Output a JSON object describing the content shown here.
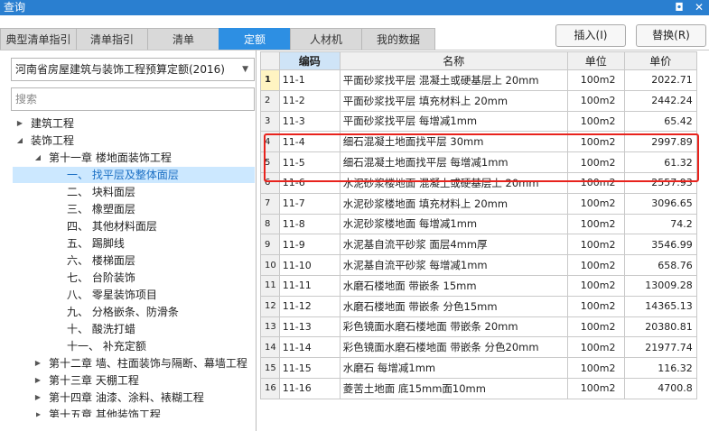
{
  "window": {
    "title": "查询",
    "restore_glyph": "◘",
    "close_glyph": "✕"
  },
  "tabs": [
    {
      "label": "典型清单指引",
      "active": false
    },
    {
      "label": "清单指引",
      "active": false
    },
    {
      "label": "清单",
      "active": false
    },
    {
      "label": "定额",
      "active": true
    },
    {
      "label": "人材机",
      "active": false
    },
    {
      "label": "我的数据",
      "active": false
    }
  ],
  "buttons": {
    "insert": "插入(I)",
    "replace": "替换(R)"
  },
  "left": {
    "quota_set": "河南省房屋建筑与装饰工程预算定额(2016)",
    "search_placeholder": "搜索"
  },
  "tree": [
    {
      "label": "建筑工程",
      "expanded": false
    },
    {
      "label": "装饰工程",
      "expanded": true
    },
    {
      "label": "第十一章 楼地面装饰工程",
      "expanded": true
    },
    {
      "label": "一、 找平层及整体面层",
      "selected": true
    },
    {
      "label": "二、 块料面层"
    },
    {
      "label": "三、 橡塑面层"
    },
    {
      "label": "四、 其他材料面层"
    },
    {
      "label": "五、 踢脚线"
    },
    {
      "label": "六、 楼梯面层"
    },
    {
      "label": "七、 台阶装饰"
    },
    {
      "label": "八、 零星装饰项目"
    },
    {
      "label": "九、 分格嵌条、防滑条"
    },
    {
      "label": "十、 酸洗打蜡"
    },
    {
      "label": "十一、 补充定额"
    },
    {
      "label": "第十二章 墙、柱面装饰与隔断、幕墙工程",
      "expanded": false
    },
    {
      "label": "第十三章 天棚工程",
      "expanded": false
    },
    {
      "label": "第十四章 油漆、涂料、裱糊工程",
      "expanded": false
    },
    {
      "label": "第十五章 其他装饰工程",
      "expanded": false
    }
  ],
  "grid": {
    "columns": [
      "编码",
      "名称",
      "单位",
      "单价"
    ],
    "rows": [
      {
        "no": "1",
        "code": "11-1",
        "name": "平面砂浆找平层 混凝土或硬基层上 20mm",
        "unit": "100m2",
        "price": "2022.71"
      },
      {
        "no": "2",
        "code": "11-2",
        "name": "平面砂浆找平层 填充材料上 20mm",
        "unit": "100m2",
        "price": "2442.24"
      },
      {
        "no": "3",
        "code": "11-3",
        "name": "平面砂浆找平层 每增减1mm",
        "unit": "100m2",
        "price": "65.42"
      },
      {
        "no": "4",
        "code": "11-4",
        "name": "细石混凝土地面找平层 30mm",
        "unit": "100m2",
        "price": "2997.89"
      },
      {
        "no": "5",
        "code": "11-5",
        "name": "细石混凝土地面找平层 每增减1mm",
        "unit": "100m2",
        "price": "61.32"
      },
      {
        "no": "6",
        "code": "11-6",
        "name": "水泥砂浆楼地面 混凝土或硬基层上 20mm",
        "unit": "100m2",
        "price": "2557.93"
      },
      {
        "no": "7",
        "code": "11-7",
        "name": "水泥砂浆楼地面 填充材料上 20mm",
        "unit": "100m2",
        "price": "3096.65"
      },
      {
        "no": "8",
        "code": "11-8",
        "name": "水泥砂浆楼地面 每增减1mm",
        "unit": "100m2",
        "price": "74.2"
      },
      {
        "no": "9",
        "code": "11-9",
        "name": "水泥基自流平砂浆 面层4mm厚",
        "unit": "100m2",
        "price": "3546.99"
      },
      {
        "no": "10",
        "code": "11-10",
        "name": "水泥基自流平砂浆 每增减1mm",
        "unit": "100m2",
        "price": "658.76"
      },
      {
        "no": "11",
        "code": "11-11",
        "name": "水磨石楼地面 带嵌条 15mm",
        "unit": "100m2",
        "price": "13009.28"
      },
      {
        "no": "12",
        "code": "11-12",
        "name": "水磨石楼地面 带嵌条 分色15mm",
        "unit": "100m2",
        "price": "14365.13"
      },
      {
        "no": "13",
        "code": "11-13",
        "name": "彩色镜面水磨石楼地面 带嵌条 20mm",
        "unit": "100m2",
        "price": "20380.81"
      },
      {
        "no": "14",
        "code": "11-14",
        "name": "彩色镜面水磨石楼地面 带嵌条 分色20mm",
        "unit": "100m2",
        "price": "21977.74"
      },
      {
        "no": "15",
        "code": "11-15",
        "name": "水磨石 每增减1mm",
        "unit": "100m2",
        "price": "116.32"
      },
      {
        "no": "16",
        "code": "11-16",
        "name": "菱苦土地面 底15mm面10mm",
        "unit": "100m2",
        "price": "4700.8"
      }
    ]
  },
  "colors": {
    "accent": "#2d8fe3",
    "titlebar": "#2a7fd0",
    "highlight_box": "#e8231d",
    "tree_selected": "#cce8ff"
  }
}
